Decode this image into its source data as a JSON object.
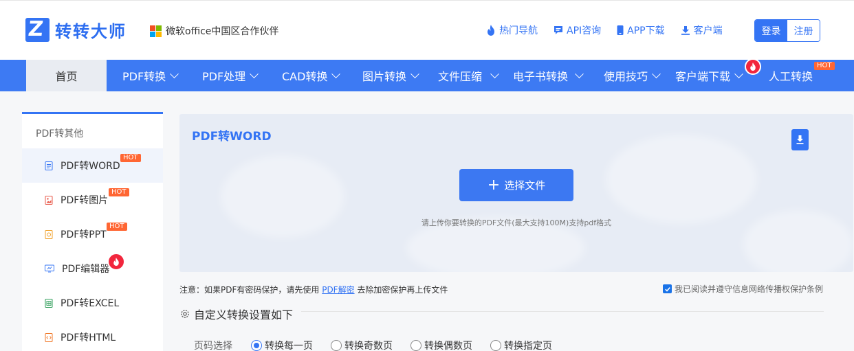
{
  "brand": {
    "name": "转转大师",
    "logo_letter": "Z",
    "partner": "微软office中国区合作伙伴"
  },
  "toplinks": [
    {
      "label": "热门导航",
      "icon": "fire-icon"
    },
    {
      "label": "API咨询",
      "icon": "chat-icon"
    },
    {
      "label": "APP下载",
      "icon": "phone-icon"
    },
    {
      "label": "客户端",
      "icon": "download-icon"
    }
  ],
  "auth": {
    "login": "登录",
    "register": "注册"
  },
  "nav": {
    "home": "首页",
    "items": [
      "PDF转换",
      "PDF处理",
      "CAD转换",
      "图片转换",
      "文件压缩",
      "电子书转换",
      "使用技巧",
      "客户端下载",
      "人工转换"
    ],
    "hot": "HOT"
  },
  "sidebar": {
    "title": "PDF转其他",
    "items": [
      {
        "label": "PDF转WORD",
        "badge": "HOT"
      },
      {
        "label": "PDF转图片",
        "badge": "HOT"
      },
      {
        "label": "PDF转PPT",
        "badge": "HOT"
      },
      {
        "label": "PDF编辑器",
        "badge": ""
      },
      {
        "label": "PDF转EXCEL",
        "badge": ""
      },
      {
        "label": "PDF转HTML",
        "badge": ""
      }
    ]
  },
  "upload": {
    "title": "PDF转WORD",
    "button": "选择文件",
    "hint": "请上传你要转换的PDF文件(最大支持100M)支持pdf格式"
  },
  "notice": {
    "before": "注意：如果PDF有密码保护，请先使用 ",
    "link": "PDF解密",
    "after": " 去除加密保护再上传文件"
  },
  "agree": "我已阅读并遵守信息网络传播权保护条例",
  "settings": {
    "title": "自定义转换设置如下"
  },
  "pages": {
    "label": "页码选择",
    "options": [
      "转换每一页",
      "转换奇数页",
      "转换偶数页",
      "转换指定页"
    ],
    "selected": "转换每一页"
  },
  "colors": {
    "primary": "#3474f4",
    "nav": "#3d7af3",
    "hot": "#ff6633",
    "fire": "#f2263d"
  }
}
